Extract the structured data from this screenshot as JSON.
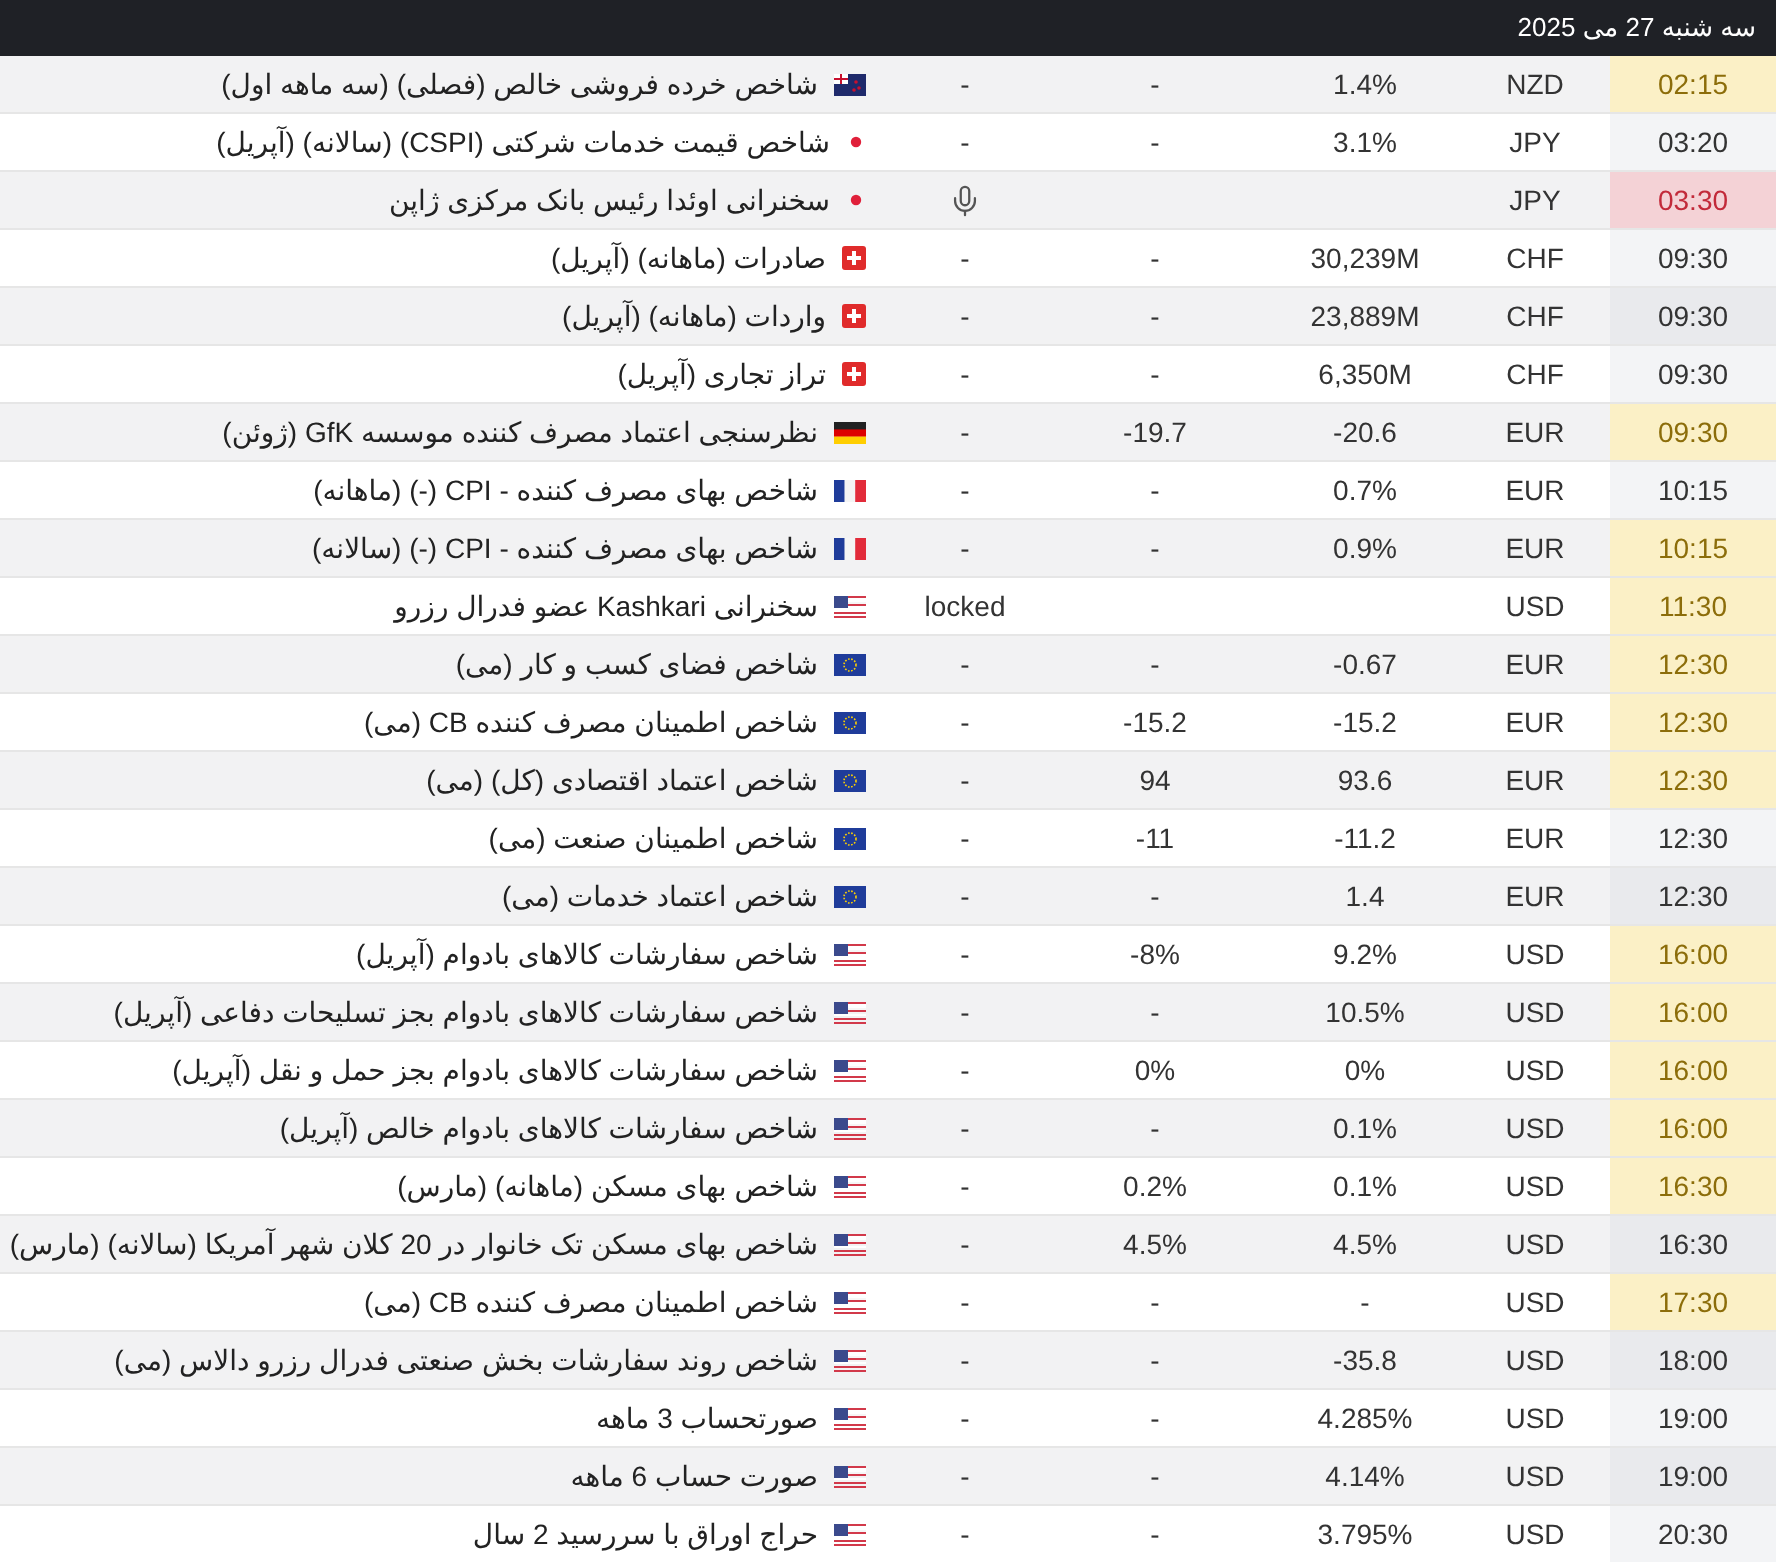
{
  "header": {
    "date": "سه شنبه 27 می 2025"
  },
  "rows": [
    {
      "time": "02:15",
      "color": "#fbf0c6",
      "currency": "NZD",
      "col_3": "1.4%",
      "col_4": "-",
      "col_5": "-",
      "flag": {
        "kind": "nz"
      },
      "event": "شاخص خرده فروشی خالص (فصلی) (سه ماهه اول)"
    },
    {
      "time": "03:20",
      "currency": "JPY",
      "col_3": "3.1%",
      "col_4": "-",
      "col_5": "-",
      "flag": {
        "kind": "jp"
      },
      "event": "شاخص قیمت خدمات شرکتی (CSPI) (سالانه) (آپریل)"
    },
    {
      "time": "03:30",
      "color": "#f4d2d6",
      "currency": "JPY",
      "kind": "speech",
      "flag": {
        "kind": "jp"
      },
      "event": "سخنرانی اوئدا رئیس بانک مرکزی ژاپن"
    },
    {
      "time": "09:30",
      "currency": "CHF",
      "col_3": "30,239M",
      "col_4": "-",
      "col_5": "-",
      "flag": {
        "kind": "ch"
      },
      "event": "صادرات (ماهانه) (آپریل)"
    },
    {
      "time": "09:30",
      "currency": "CHF",
      "col_3": "23,889M",
      "col_4": "-",
      "col_5": "-",
      "flag": {
        "kind": "ch"
      },
      "event": "واردات (ماهانه) (آپریل)"
    },
    {
      "time": "09:30",
      "currency": "CHF",
      "col_3": "6,350M",
      "col_4": "-",
      "col_5": "-",
      "flag": {
        "kind": "ch"
      },
      "event": "تراز تجاری (آپریل)"
    },
    {
      "time": "09:30",
      "color": "#fbf0c6",
      "currency": "EUR",
      "col_3": "20.6-",
      "col_4": "19.7-",
      "col_5": "-",
      "flag": {
        "kind": "de"
      },
      "event": "نظرسنجی اعتماد مصرف کننده موسسه GfK (ژوئن)"
    },
    {
      "time": "10:15",
      "currency": "EUR",
      "col_3": "0.7%",
      "col_4": "-",
      "col_5": "-",
      "flag": {
        "kind": "fr"
      },
      "event": "شاخص بهای مصرف کننده - CPI (-) (ماهانه)"
    },
    {
      "time": "10:15",
      "color": "#fbf0c6",
      "currency": "EUR",
      "col_3": "0.9%",
      "col_4": "-",
      "col_5": "-",
      "flag": {
        "kind": "fr"
      },
      "event": "شاخص بهای مصرف کننده - CPI (-) (سالانه)"
    },
    {
      "time": "11:30",
      "color": "#fbf0c6",
      "currency": "USD",
      "col_5": "locked",
      "flag": {
        "kind": "us"
      },
      "event": "سخنرانی Kashkari عضو فدرال رزرو"
    },
    {
      "time": "12:30",
      "color": "#fbf0c6",
      "currency": "EUR",
      "col_3": "0.67-",
      "col_4": "-",
      "col_5": "-",
      "flag": {
        "kind": "eu"
      },
      "event": "شاخص فضای کسب و کار (می)"
    },
    {
      "time": "12:30",
      "color": "#fbf0c6",
      "currency": "EUR",
      "col_3": "15.2-",
      "col_4": "15.2-",
      "col_5": "-",
      "flag": {
        "kind": "eu"
      },
      "event": "شاخص اطمینان مصرف کننده CB (می)"
    },
    {
      "time": "12:30",
      "color": "#fbf0c6",
      "currency": "EUR",
      "col_3": "93.6",
      "col_4": "94",
      "col_5": "-",
      "flag": {
        "kind": "eu"
      },
      "event": "شاخص اعتماد اقتصادی (کل) (می)"
    },
    {
      "time": "12:30",
      "currency": "EUR",
      "col_3": "11.2-",
      "col_4": "11-",
      "col_5": "-",
      "flag": {
        "kind": "eu"
      },
      "event": "شاخص اطمینان صنعت (می)"
    },
    {
      "time": "12:30",
      "currency": "EUR",
      "col_3": "1.4",
      "col_4": "-",
      "col_5": "-",
      "flag": {
        "kind": "eu"
      },
      "event": "شاخص اعتماد خدمات (می)"
    },
    {
      "time": "16:00",
      "color": "#fbf0c6",
      "currency": "USD",
      "col_3": "9.2%",
      "col_4": "8%-",
      "col_5": "-",
      "flag": {
        "kind": "us"
      },
      "event": "شاخص سفارشات کالاهای بادوام (آپریل)"
    },
    {
      "time": "16:00",
      "color": "#fbf0c6",
      "currency": "USD",
      "col_3": "10.5%",
      "col_4": "-",
      "col_5": "-",
      "flag": {
        "kind": "us"
      },
      "event": "شاخص سفارشات کالاهای بادوام بجز تسلیحات دفاعی (آپریل)"
    },
    {
      "time": "16:00",
      "color": "#fbf0c6",
      "currency": "USD",
      "col_3": "0%",
      "col_4": "0%",
      "col_5": "-",
      "flag": {
        "kind": "us"
      },
      "event": "شاخص سفارشات کالاهای بادوام بجز حمل و نقل (آپریل)"
    },
    {
      "time": "16:00",
      "color": "#fbf0c6",
      "currency": "USD",
      "col_3": "0.1%",
      "col_4": "-",
      "col_5": "-",
      "flag": {
        "kind": "us"
      },
      "event": "شاخص سفارشات کالاهای بادوام خالص (آپریل)"
    },
    {
      "time": "16:30",
      "color": "#fbf0c6",
      "currency": "USD",
      "col_3": "0.1%",
      "col_4": "0.2%",
      "col_5": "-",
      "flag": {
        "kind": "us"
      },
      "event": "شاخص بهای مسکن (ماهانه) (مارس)"
    },
    {
      "time": "16:30",
      "currency": "USD",
      "col_3": "4.5%",
      "col_4": "4.5%",
      "col_5": "-",
      "flag": {
        "kind": "us"
      },
      "event": "شاخص بهای مسکن تک خانوار در 20 کلان شهر آمریکا (سالانه) (مارس)"
    },
    {
      "time": "17:30",
      "color": "#fbf0c6",
      "currency": "USD",
      "col_3": "-",
      "col_4": "-",
      "col_5": "-",
      "flag": {
        "kind": "us"
      },
      "event": "شاخص اطمینان مصرف کننده CB (می)"
    },
    {
      "time": "18:00",
      "currency": "USD",
      "col_3": "35.8-",
      "col_4": "-",
      "col_5": "-",
      "flag": {
        "kind": "us"
      },
      "event": "شاخص روند سفارشات بخش صنعتی فدرال رزرو دالاس (می)"
    },
    {
      "time": "19:00",
      "currency": "USD",
      "col_3": "4.285%",
      "col_4": "-",
      "col_5": "-",
      "flag": {
        "kind": "us"
      },
      "event": "صورتحساب 3 ماهه"
    },
    {
      "time": "19:00",
      "currency": "USD",
      "col_3": "4.14%",
      "col_4": "-",
      "col_5": "-",
      "flag": {
        "kind": "us"
      },
      "event": "صورت حساب 6 ماهه"
    },
    {
      "time": "20:30",
      "currency": "USD",
      "col_3": "3.795%",
      "col_4": "-",
      "col_5": "-",
      "flag": {
        "kind": "us"
      },
      "event": "حراج اوراق با سررسید 2 سال"
    }
  ]
}
